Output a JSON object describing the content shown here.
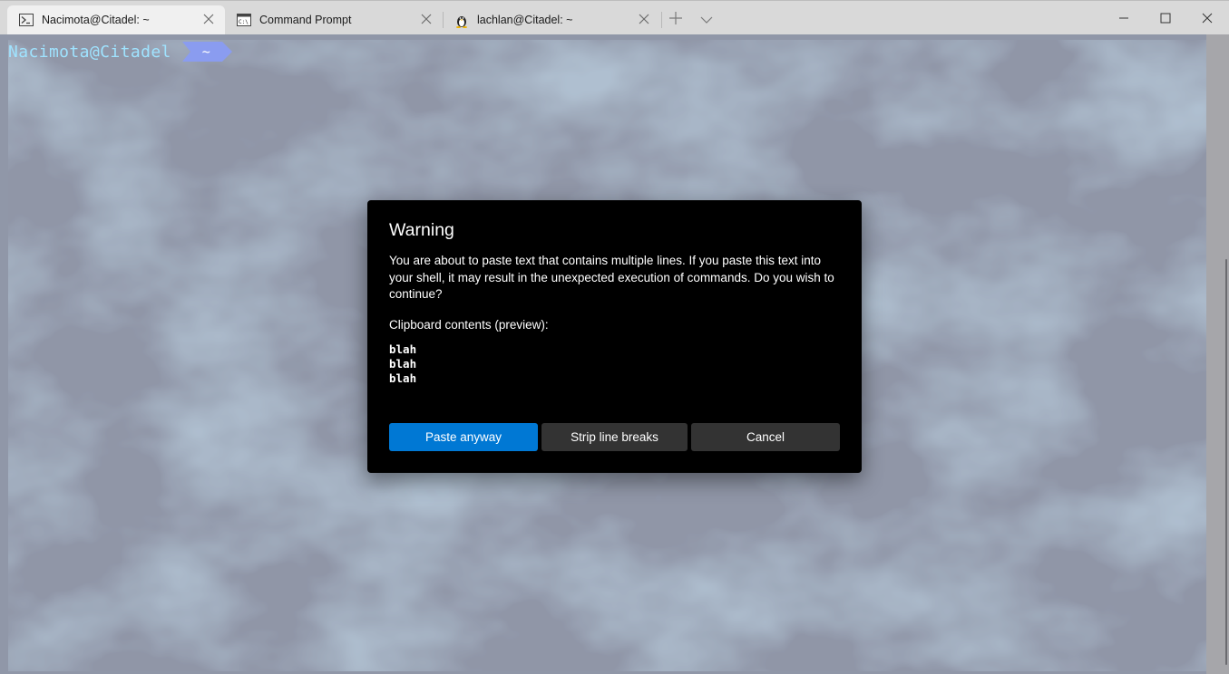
{
  "tabs": [
    {
      "title": "Nacimota@Citadel: ~",
      "icon": "powershell-icon",
      "active": true
    },
    {
      "title": "Command Prompt",
      "icon": "cmd-icon",
      "active": false
    },
    {
      "title": "lachlan@Citadel: ~",
      "icon": "linux-penguin-icon",
      "active": false
    }
  ],
  "terminal": {
    "prompt_user": "Nacimota@Citadel",
    "prompt_path": "~"
  },
  "dialog": {
    "title": "Warning",
    "message": "You are about to paste text that contains multiple lines. If you paste this text into your shell, it may result in the unexpected execution of commands. Do you wish to continue?",
    "preview_label": "Clipboard contents (preview):",
    "preview_lines": [
      "blah",
      "blah",
      "blah"
    ],
    "buttons": {
      "paste": "Paste anyway",
      "strip": "Strip line breaks",
      "cancel": "Cancel"
    }
  },
  "colors": {
    "accent": "#0078d4",
    "prompt_user": "#9fe3ff",
    "prompt_segment": "#8a9cf0"
  }
}
